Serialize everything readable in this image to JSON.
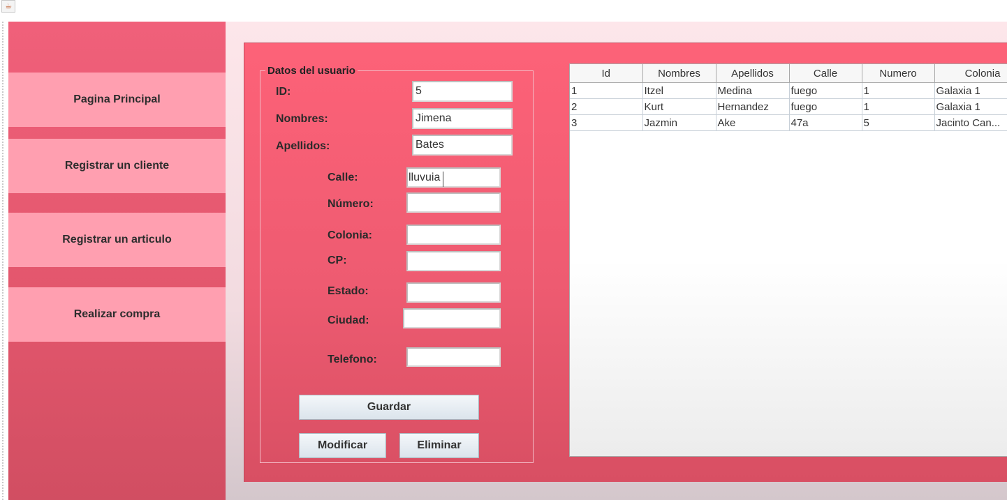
{
  "app": {
    "icon": "java-cup-icon"
  },
  "sidebar": {
    "items": [
      {
        "label": "Pagina Principal"
      },
      {
        "label": "Registrar un cliente"
      },
      {
        "label": "Registrar un articulo"
      },
      {
        "label": "Realizar compra"
      }
    ]
  },
  "form": {
    "group_title": "Datos del usuario",
    "fields": {
      "id": {
        "label": "ID:",
        "value": "5"
      },
      "nombres": {
        "label": "Nombres:",
        "value": "Jimena"
      },
      "apellidos": {
        "label": "Apellidos:",
        "value": "Bates"
      },
      "calle": {
        "label": "Calle:",
        "value": "lluvuia"
      },
      "numero": {
        "label": "Número:",
        "value": ""
      },
      "colonia": {
        "label": "Colonia:",
        "value": ""
      },
      "cp": {
        "label": "CP:",
        "value": ""
      },
      "estado": {
        "label": "Estado:",
        "value": ""
      },
      "ciudad": {
        "label": "Ciudad:",
        "value": ""
      },
      "telefono": {
        "label": "Telefono:",
        "value": ""
      }
    },
    "buttons": {
      "guardar": "Guardar",
      "modificar": "Modificar",
      "eliminar": "Eliminar"
    }
  },
  "table": {
    "columns": [
      "Id",
      "Nombres",
      "Apellidos",
      "Calle",
      "Numero",
      "Colonia"
    ],
    "rows": [
      [
        "1",
        "Itzel",
        "Medina",
        "fuego",
        "1",
        "Galaxia 1"
      ],
      [
        "2",
        "Kurt",
        "Hernandez",
        "fuego",
        "1",
        "Galaxia 1"
      ],
      [
        "3",
        "Jazmin",
        "Ake",
        "47a",
        "5",
        "Jacinto Can..."
      ]
    ]
  },
  "colors": {
    "sidebar": "#f0607a",
    "sidebar_button": "#ff9fb0",
    "panel": "#fd6278",
    "background": "#fde6ea"
  }
}
